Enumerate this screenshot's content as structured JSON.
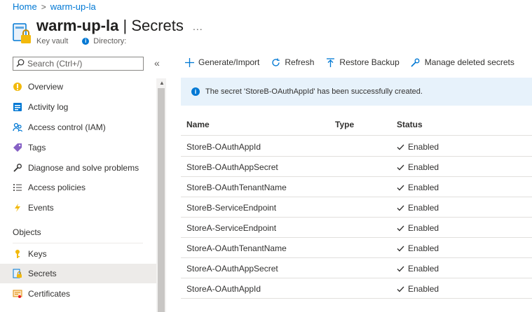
{
  "breadcrumb": {
    "home": "Home",
    "separator": ">",
    "current": "warm-up-la"
  },
  "header": {
    "title_resource": "warm-up-la",
    "title_separator": " | ",
    "title_blade": "Secrets",
    "more": "...",
    "subtitle_type": "Key vault",
    "subtitle_directory": "Directory:"
  },
  "sidebar": {
    "search_placeholder": "Search (Ctrl+/)",
    "collapse": "«",
    "items": [
      {
        "label": "Overview",
        "icon": "overview-icon"
      },
      {
        "label": "Activity log",
        "icon": "activity-log-icon"
      },
      {
        "label": "Access control (IAM)",
        "icon": "iam-icon"
      },
      {
        "label": "Tags",
        "icon": "tag-icon"
      },
      {
        "label": "Diagnose and solve problems",
        "icon": "wrench-icon"
      },
      {
        "label": "Access policies",
        "icon": "list-icon"
      },
      {
        "label": "Events",
        "icon": "lightning-icon"
      }
    ],
    "section_objects": "Objects",
    "object_items": [
      {
        "label": "Keys",
        "icon": "key-icon"
      },
      {
        "label": "Secrets",
        "icon": "secret-icon",
        "selected": true
      },
      {
        "label": "Certificates",
        "icon": "certificate-icon"
      }
    ]
  },
  "toolbar": {
    "generate": "Generate/Import",
    "refresh": "Refresh",
    "restore": "Restore Backup",
    "manage_deleted": "Manage deleted secrets"
  },
  "notification": {
    "text": "The secret 'StoreB-OAuthAppId' has been successfully created."
  },
  "table": {
    "columns": {
      "name": "Name",
      "type": "Type",
      "status": "Status"
    },
    "rows": [
      {
        "name": "StoreB-OAuthAppId",
        "type": "",
        "status": "Enabled"
      },
      {
        "name": "StoreB-OAuthAppSecret",
        "type": "",
        "status": "Enabled"
      },
      {
        "name": "StoreB-OAuthTenantName",
        "type": "",
        "status": "Enabled"
      },
      {
        "name": "StoreB-ServiceEndpoint",
        "type": "",
        "status": "Enabled"
      },
      {
        "name": "StoreA-ServiceEndpoint",
        "type": "",
        "status": "Enabled"
      },
      {
        "name": "StoreA-OAuthTenantName",
        "type": "",
        "status": "Enabled"
      },
      {
        "name": "StoreA-OAuthAppSecret",
        "type": "",
        "status": "Enabled"
      },
      {
        "name": "StoreA-OAuthAppId",
        "type": "",
        "status": "Enabled"
      }
    ]
  },
  "colors": {
    "accent": "#0078d4",
    "selected_bg": "#edebe9",
    "notice_bg": "#e7f2fb",
    "key_gold": "#f2b90c"
  }
}
